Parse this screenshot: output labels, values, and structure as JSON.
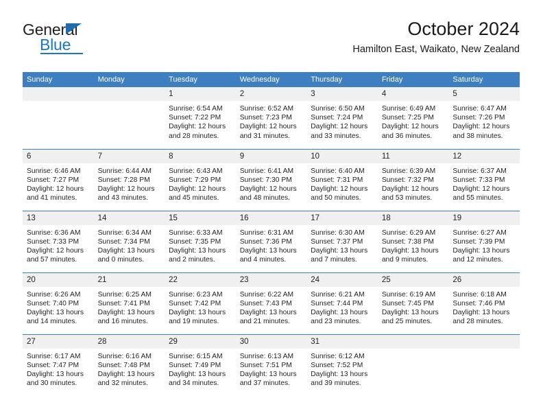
{
  "logo": {
    "word_one": "General",
    "word_two": "Blue",
    "triangle_color": "#1f6cb0",
    "blue_color": "#1878c8"
  },
  "header": {
    "month_title": "October 2024",
    "location": "Hamilton East, Waikato, New Zealand"
  },
  "theme": {
    "header_blue": "#3e7fc1",
    "daynum_band": "#f0f0f0",
    "text": "#231f20"
  },
  "calendar": {
    "weekday_headers": [
      "Sunday",
      "Monday",
      "Tuesday",
      "Wednesday",
      "Thursday",
      "Friday",
      "Saturday"
    ],
    "weeks": [
      [
        {
          "day": "",
          "empty": true,
          "lines": []
        },
        {
          "day": "",
          "empty": true,
          "lines": []
        },
        {
          "day": "1",
          "lines": [
            "Sunrise: 6:54 AM",
            "Sunset: 7:22 PM",
            "Daylight: 12 hours",
            "and 28 minutes."
          ]
        },
        {
          "day": "2",
          "lines": [
            "Sunrise: 6:52 AM",
            "Sunset: 7:23 PM",
            "Daylight: 12 hours",
            "and 31 minutes."
          ]
        },
        {
          "day": "3",
          "lines": [
            "Sunrise: 6:50 AM",
            "Sunset: 7:24 PM",
            "Daylight: 12 hours",
            "and 33 minutes."
          ]
        },
        {
          "day": "4",
          "lines": [
            "Sunrise: 6:49 AM",
            "Sunset: 7:25 PM",
            "Daylight: 12 hours",
            "and 36 minutes."
          ]
        },
        {
          "day": "5",
          "lines": [
            "Sunrise: 6:47 AM",
            "Sunset: 7:26 PM",
            "Daylight: 12 hours",
            "and 38 minutes."
          ]
        }
      ],
      [
        {
          "day": "6",
          "lines": [
            "Sunrise: 6:46 AM",
            "Sunset: 7:27 PM",
            "Daylight: 12 hours",
            "and 41 minutes."
          ]
        },
        {
          "day": "7",
          "lines": [
            "Sunrise: 6:44 AM",
            "Sunset: 7:28 PM",
            "Daylight: 12 hours",
            "and 43 minutes."
          ]
        },
        {
          "day": "8",
          "lines": [
            "Sunrise: 6:43 AM",
            "Sunset: 7:29 PM",
            "Daylight: 12 hours",
            "and 45 minutes."
          ]
        },
        {
          "day": "9",
          "lines": [
            "Sunrise: 6:41 AM",
            "Sunset: 7:30 PM",
            "Daylight: 12 hours",
            "and 48 minutes."
          ]
        },
        {
          "day": "10",
          "lines": [
            "Sunrise: 6:40 AM",
            "Sunset: 7:31 PM",
            "Daylight: 12 hours",
            "and 50 minutes."
          ]
        },
        {
          "day": "11",
          "lines": [
            "Sunrise: 6:39 AM",
            "Sunset: 7:32 PM",
            "Daylight: 12 hours",
            "and 53 minutes."
          ]
        },
        {
          "day": "12",
          "lines": [
            "Sunrise: 6:37 AM",
            "Sunset: 7:33 PM",
            "Daylight: 12 hours",
            "and 55 minutes."
          ]
        }
      ],
      [
        {
          "day": "13",
          "lines": [
            "Sunrise: 6:36 AM",
            "Sunset: 7:33 PM",
            "Daylight: 12 hours",
            "and 57 minutes."
          ]
        },
        {
          "day": "14",
          "lines": [
            "Sunrise: 6:34 AM",
            "Sunset: 7:34 PM",
            "Daylight: 13 hours",
            "and 0 minutes."
          ]
        },
        {
          "day": "15",
          "lines": [
            "Sunrise: 6:33 AM",
            "Sunset: 7:35 PM",
            "Daylight: 13 hours",
            "and 2 minutes."
          ]
        },
        {
          "day": "16",
          "lines": [
            "Sunrise: 6:31 AM",
            "Sunset: 7:36 PM",
            "Daylight: 13 hours",
            "and 4 minutes."
          ]
        },
        {
          "day": "17",
          "lines": [
            "Sunrise: 6:30 AM",
            "Sunset: 7:37 PM",
            "Daylight: 13 hours",
            "and 7 minutes."
          ]
        },
        {
          "day": "18",
          "lines": [
            "Sunrise: 6:29 AM",
            "Sunset: 7:38 PM",
            "Daylight: 13 hours",
            "and 9 minutes."
          ]
        },
        {
          "day": "19",
          "lines": [
            "Sunrise: 6:27 AM",
            "Sunset: 7:39 PM",
            "Daylight: 13 hours",
            "and 12 minutes."
          ]
        }
      ],
      [
        {
          "day": "20",
          "lines": [
            "Sunrise: 6:26 AM",
            "Sunset: 7:40 PM",
            "Daylight: 13 hours",
            "and 14 minutes."
          ]
        },
        {
          "day": "21",
          "lines": [
            "Sunrise: 6:25 AM",
            "Sunset: 7:41 PM",
            "Daylight: 13 hours",
            "and 16 minutes."
          ]
        },
        {
          "day": "22",
          "lines": [
            "Sunrise: 6:23 AM",
            "Sunset: 7:42 PM",
            "Daylight: 13 hours",
            "and 19 minutes."
          ]
        },
        {
          "day": "23",
          "lines": [
            "Sunrise: 6:22 AM",
            "Sunset: 7:43 PM",
            "Daylight: 13 hours",
            "and 21 minutes."
          ]
        },
        {
          "day": "24",
          "lines": [
            "Sunrise: 6:21 AM",
            "Sunset: 7:44 PM",
            "Daylight: 13 hours",
            "and 23 minutes."
          ]
        },
        {
          "day": "25",
          "lines": [
            "Sunrise: 6:19 AM",
            "Sunset: 7:45 PM",
            "Daylight: 13 hours",
            "and 25 minutes."
          ]
        },
        {
          "day": "26",
          "lines": [
            "Sunrise: 6:18 AM",
            "Sunset: 7:46 PM",
            "Daylight: 13 hours",
            "and 28 minutes."
          ]
        }
      ],
      [
        {
          "day": "27",
          "lines": [
            "Sunrise: 6:17 AM",
            "Sunset: 7:47 PM",
            "Daylight: 13 hours",
            "and 30 minutes."
          ]
        },
        {
          "day": "28",
          "lines": [
            "Sunrise: 6:16 AM",
            "Sunset: 7:48 PM",
            "Daylight: 13 hours",
            "and 32 minutes."
          ]
        },
        {
          "day": "29",
          "lines": [
            "Sunrise: 6:15 AM",
            "Sunset: 7:49 PM",
            "Daylight: 13 hours",
            "and 34 minutes."
          ]
        },
        {
          "day": "30",
          "lines": [
            "Sunrise: 6:13 AM",
            "Sunset: 7:51 PM",
            "Daylight: 13 hours",
            "and 37 minutes."
          ]
        },
        {
          "day": "31",
          "lines": [
            "Sunrise: 6:12 AM",
            "Sunset: 7:52 PM",
            "Daylight: 13 hours",
            "and 39 minutes."
          ]
        },
        {
          "day": "",
          "empty": true,
          "lines": []
        },
        {
          "day": "",
          "empty": true,
          "lines": []
        }
      ]
    ]
  }
}
